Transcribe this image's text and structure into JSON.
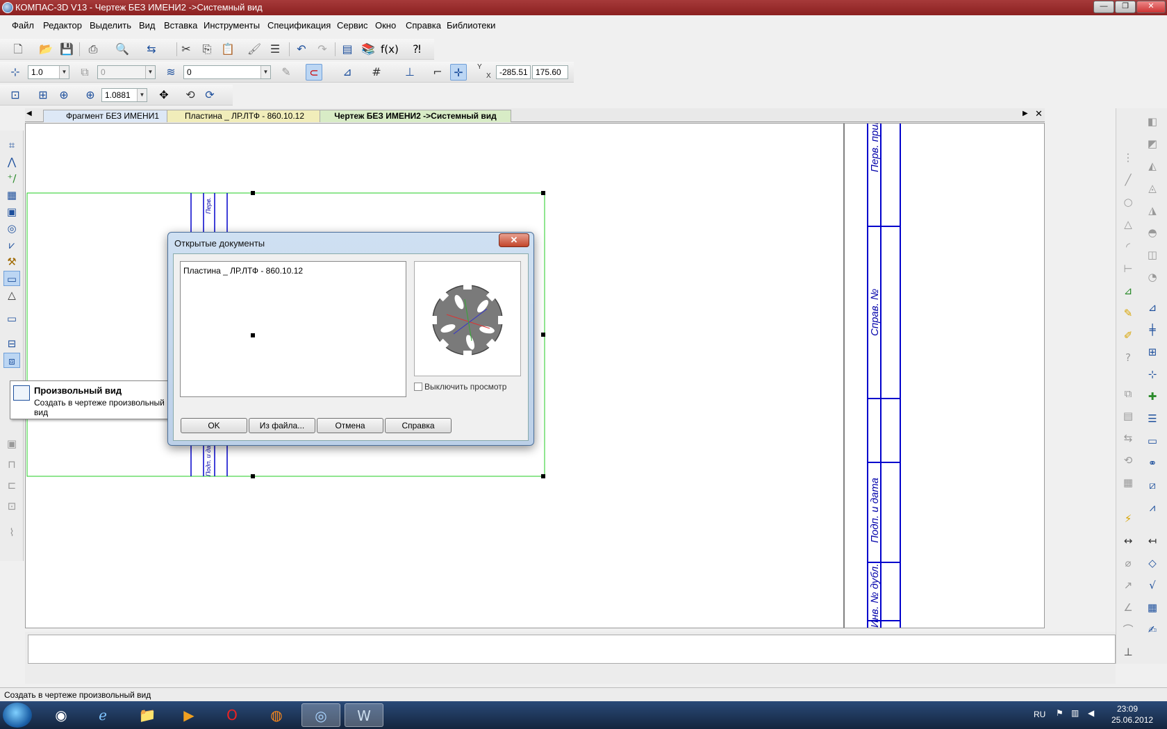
{
  "window": {
    "title": "КОМПАС-3D V13 - Чертеж БЕЗ ИМЕНИ2 ->Системный вид",
    "min_glyph": "—",
    "max_glyph": "❐",
    "close_glyph": "✕"
  },
  "menu": [
    {
      "label": "Файл"
    },
    {
      "label": "Редактор"
    },
    {
      "label": "Выделить"
    },
    {
      "label": "Вид"
    },
    {
      "label": "Вставка"
    },
    {
      "label": "Инструменты"
    },
    {
      "label": "Спецификация"
    },
    {
      "label": "Сервис"
    },
    {
      "label": "Окно"
    },
    {
      "label": "Справка"
    },
    {
      "label": "Библиотеки"
    }
  ],
  "toolbar2": {
    "step_value": "1.0",
    "layer_value": "0",
    "style_value": "0",
    "coord_x": "-285.51",
    "coord_y": "175.60",
    "coord_y_label": "Y",
    "coord_x_label": "X"
  },
  "toolbar3": {
    "zoom_value": "1.0881"
  },
  "tabs": [
    {
      "label": "Фрагмент БЕЗ ИМЕНИ1"
    },
    {
      "label": "Пластина _ ЛР.ЛТФ - 860.10.12"
    },
    {
      "label": "Чертеж БЕЗ ИМЕНИ2 ->Системный вид"
    }
  ],
  "drawing": {
    "stamp_labels": [
      "Перв. прим.",
      "Справ. №",
      "Подп. и дата",
      "Инв. № дубл."
    ],
    "left_stamp_labels": [
      "Перв.",
      "Подп. и дата"
    ],
    "frame_color": "#0000cc",
    "selection_color": "#22cc22"
  },
  "tooltip": {
    "title": "Произвольный вид",
    "description": "Создать в чертеже произвольный вид"
  },
  "dialog": {
    "title": "Открытые документы",
    "close_glyph": "✕",
    "documents": [
      "Пластина _ ЛР.ЛТФ - 860.10.12"
    ],
    "disable_preview_label": "Выключить просмотр",
    "buttons": {
      "ok": "OK",
      "from_file": "Из файла...",
      "cancel": "Отмена",
      "help": "Справка"
    }
  },
  "status": {
    "text": "Создать в чертеже произвольный вид"
  },
  "taskbar": {
    "language": "RU",
    "time": "23:09",
    "date": "25.06.2012"
  }
}
